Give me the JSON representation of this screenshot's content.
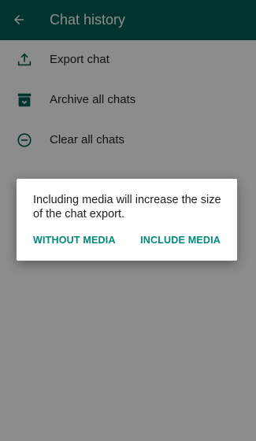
{
  "appbar": {
    "title": "Chat history",
    "back_icon": "arrow-back-icon",
    "color": "#075e54"
  },
  "menu": {
    "items": [
      {
        "label": "Export chat",
        "icon": "export-icon"
      },
      {
        "label": "Archive all chats",
        "icon": "archive-icon"
      },
      {
        "label": "Clear all chats",
        "icon": "clear-icon"
      }
    ],
    "icon_color": "#075e54"
  },
  "dialog": {
    "message": "Including media will increase the size of the chat export.",
    "buttons": {
      "without_media": "WITHOUT MEDIA",
      "include_media": "INCLUDE MEDIA"
    },
    "button_color": "#00897b"
  }
}
